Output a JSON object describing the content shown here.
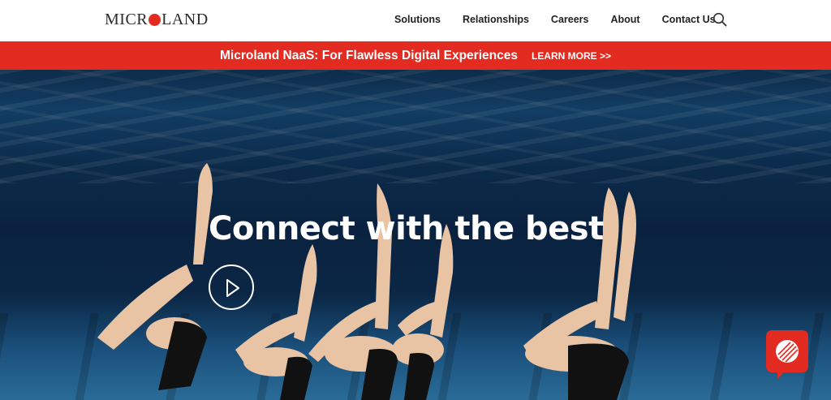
{
  "header": {
    "logo_left": "MICR",
    "logo_right": "LAND",
    "nav": [
      "Solutions",
      "Relationships",
      "Careers",
      "About",
      "Contact Us"
    ]
  },
  "banner": {
    "message": "Microland NaaS: For Flawless Digital Experiences",
    "cta": "LEARN MORE >>"
  },
  "hero": {
    "headline": "Connect with the best"
  },
  "colors": {
    "brand_red": "#e32b22",
    "water": "#0b2a4a"
  },
  "icons": {
    "search": "search-icon",
    "play": "play-icon",
    "chat": "chat-icon"
  }
}
